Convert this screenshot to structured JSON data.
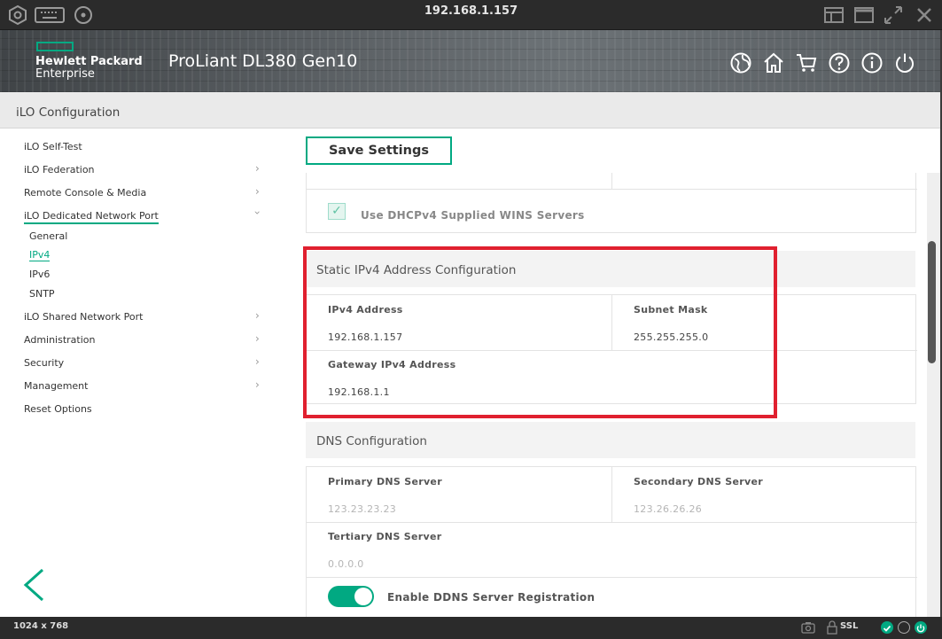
{
  "window": {
    "title": "192.168.1.157"
  },
  "brand": {
    "company_line1": "Hewlett Packard",
    "company_line2": "Enterprise",
    "product": "ProLiant DL380 Gen10"
  },
  "header": {
    "title": "iLO Configuration"
  },
  "nav": {
    "items": [
      {
        "label": "iLO Self-Test"
      },
      {
        "label": "iLO Federation"
      },
      {
        "label": "Remote Console & Media"
      },
      {
        "label": "iLO Dedicated Network Port"
      },
      {
        "label": "iLO Shared Network Port"
      },
      {
        "label": "Administration"
      },
      {
        "label": "Security"
      },
      {
        "label": "Management"
      },
      {
        "label": "Reset Options"
      }
    ],
    "subitems": [
      {
        "label": "General"
      },
      {
        "label": "IPv4"
      },
      {
        "label": "IPv6"
      },
      {
        "label": "SNTP"
      }
    ]
  },
  "toolbar": {
    "save_label": "Save Settings"
  },
  "dhcp": {
    "wins_label": "Use DHCPv4 Supplied WINS Servers",
    "wins_checked": true
  },
  "static_ipv4": {
    "title": "Static IPv4 Address Configuration",
    "ipv4_label": "IPv4 Address",
    "ipv4_value": "192.168.1.157",
    "subnet_label": "Subnet Mask",
    "subnet_value": "255.255.255.0",
    "gateway_label": "Gateway IPv4 Address",
    "gateway_value": "192.168.1.1"
  },
  "dns": {
    "title": "DNS Configuration",
    "primary_label": "Primary DNS Server",
    "primary_value": "123.23.23.23",
    "secondary_label": "Secondary DNS Server",
    "secondary_value": "123.26.26.26",
    "tertiary_label": "Tertiary DNS Server",
    "tertiary_value": "0.0.0.0",
    "ddns_label": "Enable DDNS Server Registration",
    "ddns_enabled": true
  },
  "status": {
    "resolution": "1024 x 768",
    "ssl": "SSL"
  },
  "colors": {
    "accent": "#01a982",
    "highlight": "#e0202f"
  }
}
